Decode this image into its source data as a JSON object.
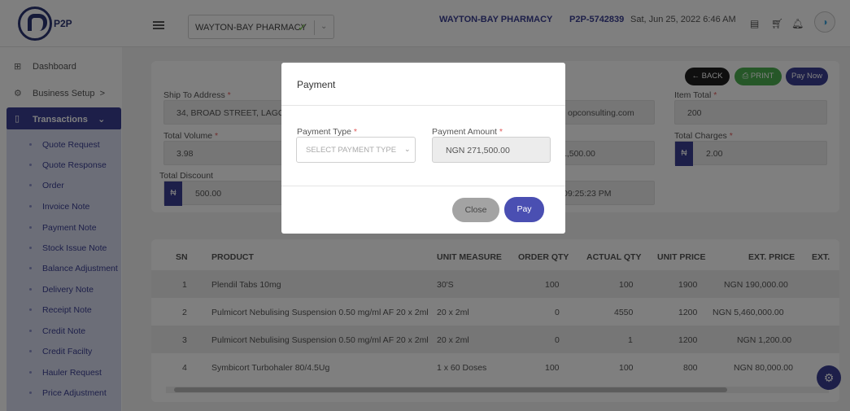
{
  "header": {
    "logo_text": "P2P",
    "store_select_value": "WAYTON-BAY PHARMACY",
    "pharmacy_name": "WAYTON-BAY PHARMACY",
    "p2p_id": "P2P-5742839",
    "datetime": "Sat, Jun 25, 2022 6:46 AM"
  },
  "sidebar": {
    "items": [
      {
        "label": "Dashboard"
      },
      {
        "label": "Business Setup",
        "chevron": ">"
      },
      {
        "label": "Transactions",
        "chevron": "⌄"
      }
    ],
    "sub_items": [
      "Quote Request",
      "Quote Response",
      "Order",
      "Invoice Note",
      "Payment Note",
      "Stock Issue Note",
      "Balance Adjustment",
      "Delivery Note",
      "Receipt Note",
      "Credit Note",
      "Credit Facilty",
      "Hauler Request",
      "Price Adjustment"
    ]
  },
  "actions": {
    "back": "BACK",
    "print": "PRINT",
    "pay_now": "Pay Now"
  },
  "form": {
    "ship_to_label": "Ship To Address",
    "ship_to_value": "34, BROAD STREET, LAGOS",
    "email_partial": "opconsulting.com",
    "item_total_label": "Item Total",
    "item_total_value": "200",
    "total_volume_label": "Total Volume",
    "total_volume_value": "3.98",
    "mid_value_partial": "1,500.00",
    "total_charges_label": "Total Charges",
    "total_charges_value": "2.00",
    "total_discount_label": "Total Discount",
    "total_discount_value": "500.00",
    "time_partial": "09:25:23 PM",
    "currency_symbol": "₦"
  },
  "table": {
    "columns": [
      "SN",
      "PRODUCT",
      "UNIT MEASURE",
      "ORDER QTY",
      "ACTUAL QTY",
      "UNIT PRICE",
      "EXT. PRICE",
      "EXT."
    ],
    "rows": [
      {
        "sn": "1",
        "product": "Plendil Tabs 10mg",
        "unit": "30'S",
        "order_qty": "100",
        "actual_qty": "100",
        "unit_price": "1900",
        "ext_price": "NGN 190,000.00"
      },
      {
        "sn": "2",
        "product": "Pulmicort Nebulising Suspension 0.50 mg/ml AF 20 x 2ml",
        "unit": "20 x 2ml",
        "order_qty": "0",
        "actual_qty": "4550",
        "unit_price": "1200",
        "ext_price": "NGN 5,460,000.00"
      },
      {
        "sn": "3",
        "product": "Pulmicort Nebulising Suspension 0.50 mg/ml AF 20 x 2ml",
        "unit": "20 x 2ml",
        "order_qty": "0",
        "actual_qty": "1",
        "unit_price": "1200",
        "ext_price": "NGN 1,200.00"
      },
      {
        "sn": "4",
        "product": "Symbicort Turbohaler 80/4.5Ug",
        "unit": "1 x 60 Doses",
        "order_qty": "100",
        "actual_qty": "100",
        "unit_price": "800",
        "ext_price": "NGN 80,000.00"
      }
    ]
  },
  "modal": {
    "title": "Payment",
    "payment_type_label": "Payment Type",
    "payment_type_placeholder": "SELECT PAYMENT TYPE",
    "payment_amount_label": "Payment Amount",
    "payment_amount_value": "NGN 271,500.00",
    "close_label": "Close",
    "pay_label": "Pay"
  }
}
